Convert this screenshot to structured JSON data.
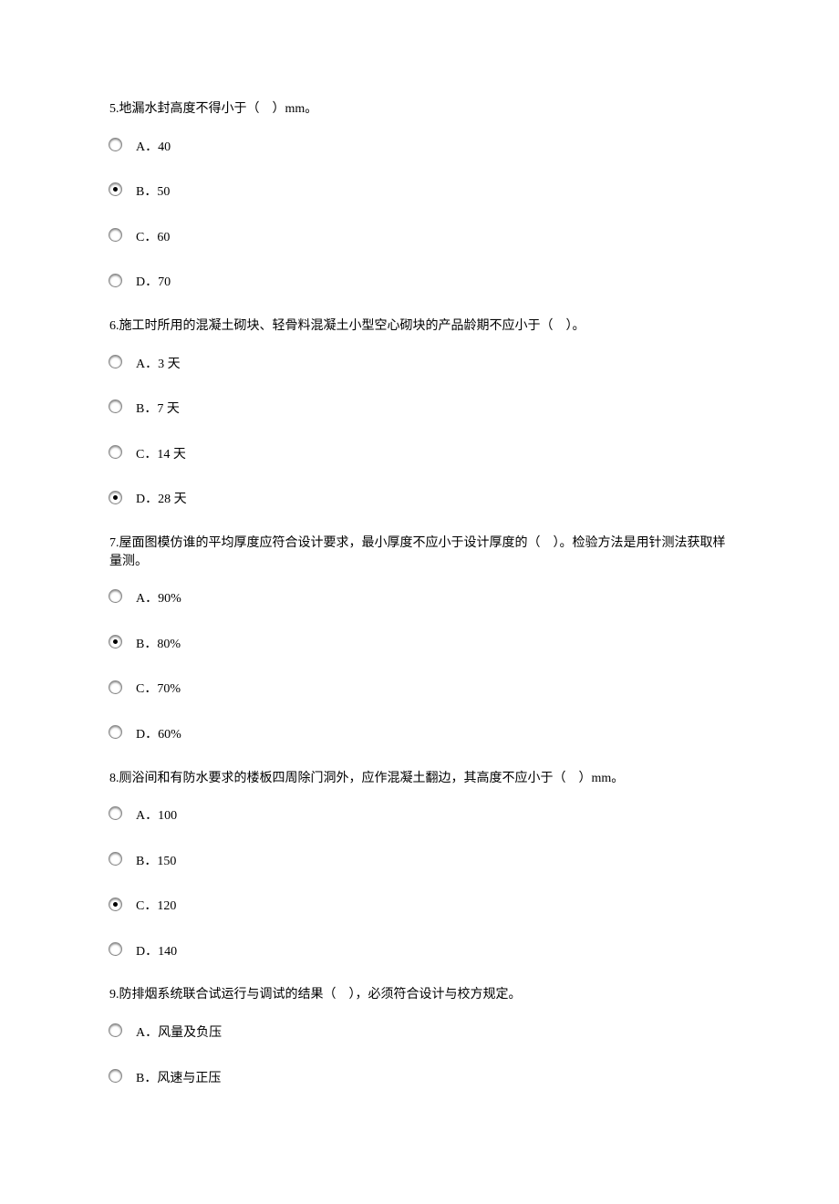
{
  "questions": [
    {
      "number": "5.",
      "text": "地漏水封高度不得小于（　）mm。",
      "options": [
        {
          "label": "A．40",
          "selected": false
        },
        {
          "label": "B．50",
          "selected": true
        },
        {
          "label": "C．60",
          "selected": false
        },
        {
          "label": "D．70",
          "selected": false
        }
      ]
    },
    {
      "number": "6.",
      "text": "施工时所用的混凝土砌块、轻骨料混凝土小型空心砌块的产品龄期不应小于（　）。",
      "options": [
        {
          "label": "A．3 天",
          "selected": false
        },
        {
          "label": "B．7 天",
          "selected": false
        },
        {
          "label": "C．14 天",
          "selected": false
        },
        {
          "label": "D．28 天",
          "selected": true
        }
      ]
    },
    {
      "number": "7.",
      "text": "屋面图模仿谁的平均厚度应符合设计要求，最小厚度不应小于设计厚度的（　）。检验方法是用针测法获取样量测。",
      "options": [
        {
          "label": "A．90%",
          "selected": false
        },
        {
          "label": "B．80%",
          "selected": true
        },
        {
          "label": "C．70%",
          "selected": false
        },
        {
          "label": "D．60%",
          "selected": false
        }
      ]
    },
    {
      "number": "8.",
      "text": "厕浴间和有防水要求的楼板四周除门洞外，应作混凝土翻边，其高度不应小于（　）mm。",
      "options": [
        {
          "label": "A．100",
          "selected": false
        },
        {
          "label": "B．150",
          "selected": false
        },
        {
          "label": "C．120",
          "selected": true
        },
        {
          "label": "D．140",
          "selected": false
        }
      ]
    },
    {
      "number": "9.",
      "text": "防排烟系统联合试运行与调试的结果（　），必须符合设计与校方规定。",
      "options": [
        {
          "label": "A．风量及负压",
          "selected": false
        },
        {
          "label": "B．风速与正压",
          "selected": false
        }
      ]
    }
  ]
}
